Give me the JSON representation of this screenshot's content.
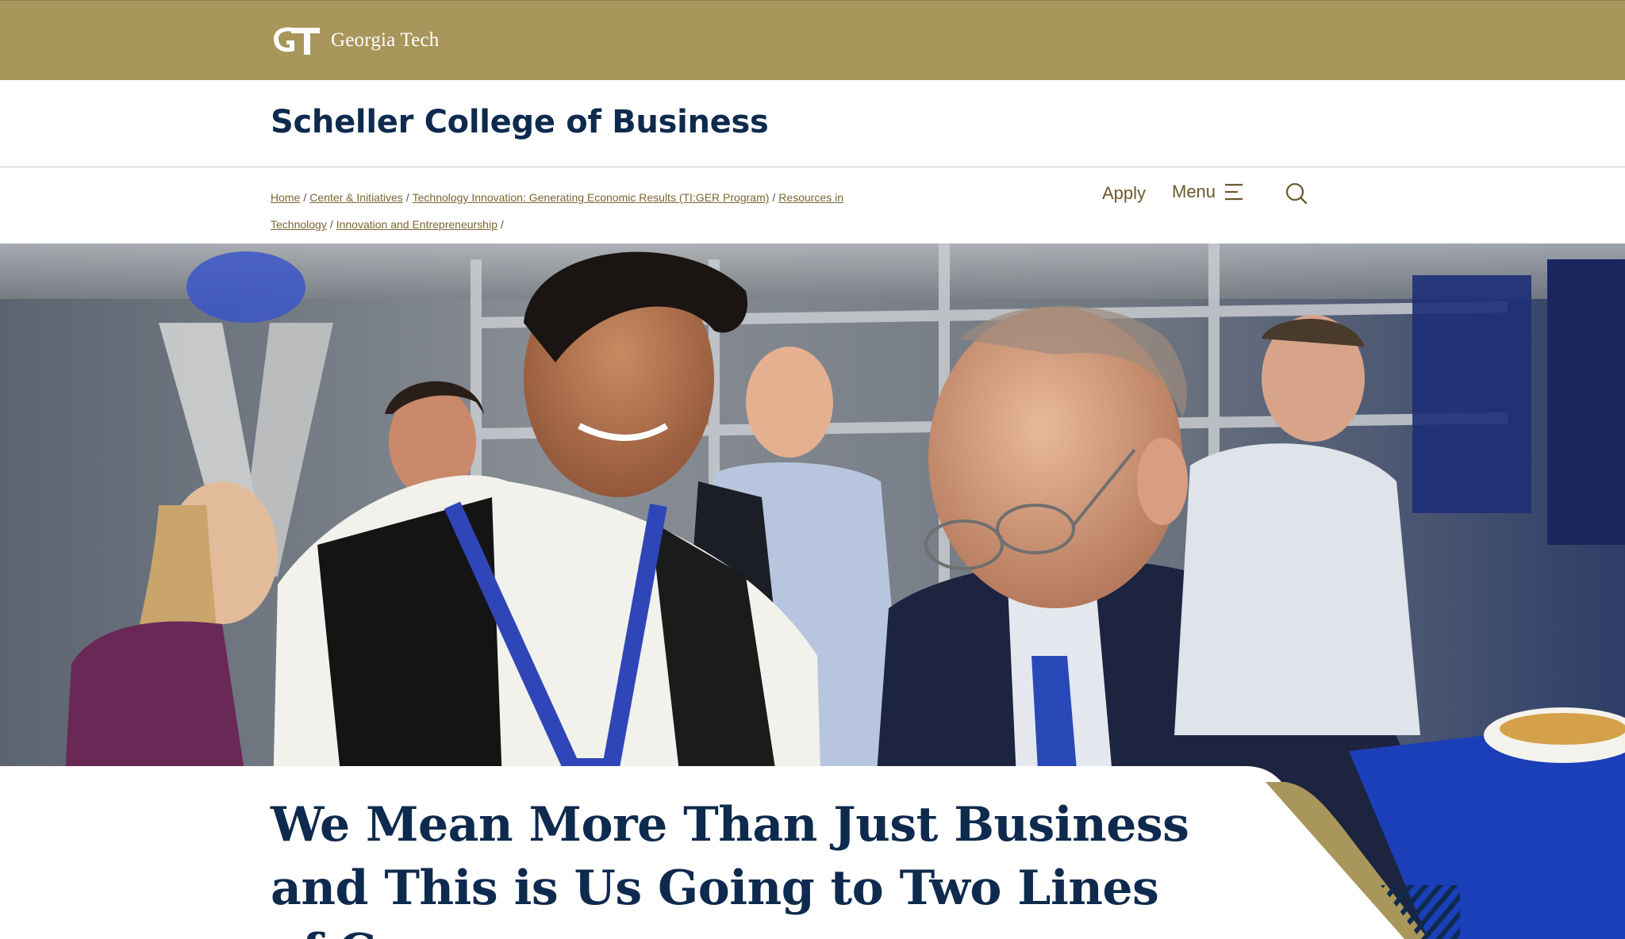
{
  "brand": {
    "logo_icon": "gt-monogram-icon",
    "wordmark": "Georgia Tech",
    "colors": {
      "gold": "#a8965a",
      "navy": "#0e2a4e",
      "gold_text": "#7a6632"
    }
  },
  "site": {
    "title": "Scheller College of Business"
  },
  "breadcrumb": [
    {
      "label": "Home"
    },
    {
      "label": "Center & Initiatives"
    },
    {
      "label": "Technology Innovation: Generating Economic Results (TI:GER Program)"
    },
    {
      "label": "Resources in Technology"
    },
    {
      "label": "Innovation and Entrepreneurship"
    }
  ],
  "nav": {
    "apply_label": "Apply",
    "menu_label": "Menu",
    "menu_icon": "hamburger-icon",
    "search_icon": "search-icon"
  },
  "hero": {
    "image": "photo-of-people-at-networking-event",
    "headline": "We Mean More Than Just Business and This is Us Going to Two Lines of Copy."
  }
}
